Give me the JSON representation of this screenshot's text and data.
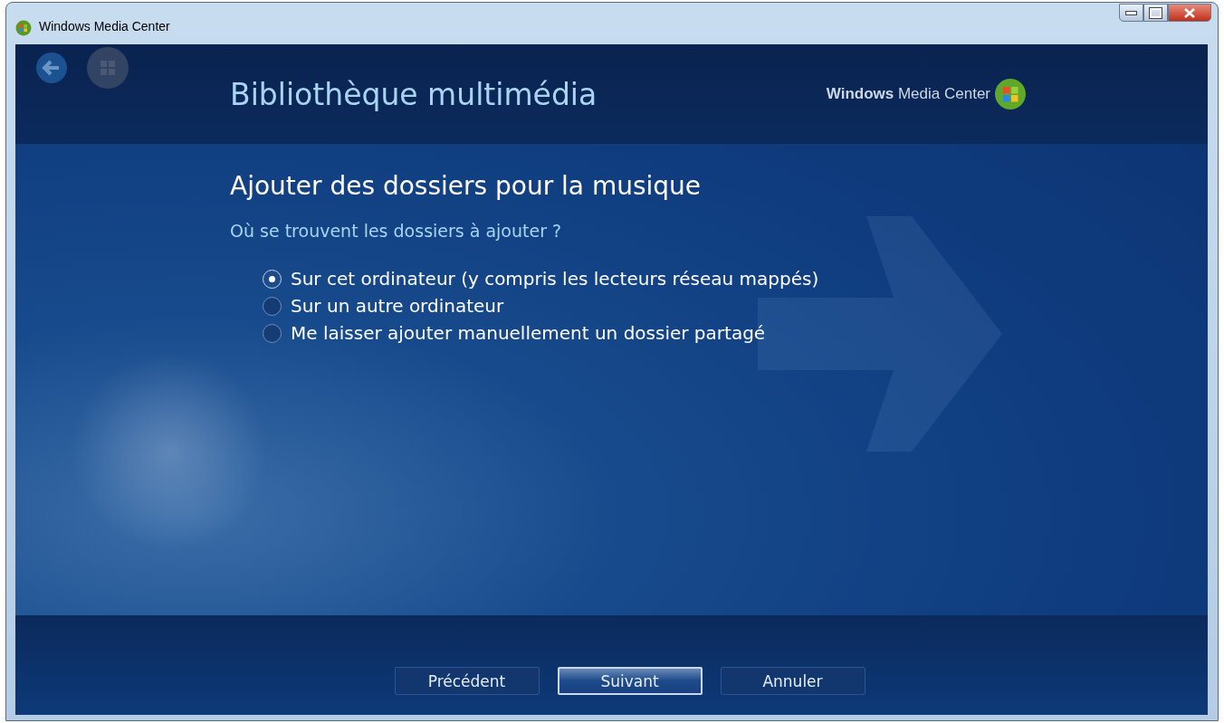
{
  "window": {
    "title": "Windows Media Center"
  },
  "header": {
    "title": "Bibliothèque multimédia",
    "logo": "**Windows** Media Center"
  },
  "page": {
    "heading": "Ajouter des dossiers pour la musique",
    "question": "Où se trouvent les dossiers à ajouter ?",
    "options": [
      {
        "label": "Sur cet ordinateur (y compris les lecteurs réseau mappés)",
        "selected": true
      },
      {
        "label": "Sur un autre ordinateur",
        "selected": false
      },
      {
        "label": "Me laisser ajouter manuellement un dossier partagé",
        "selected": false
      }
    ]
  },
  "buttons": [
    {
      "label": "Précédent",
      "selected": false
    },
    {
      "label": "Suivant",
      "selected": true
    },
    {
      "label": "Annuler",
      "selected": false
    }
  ]
}
